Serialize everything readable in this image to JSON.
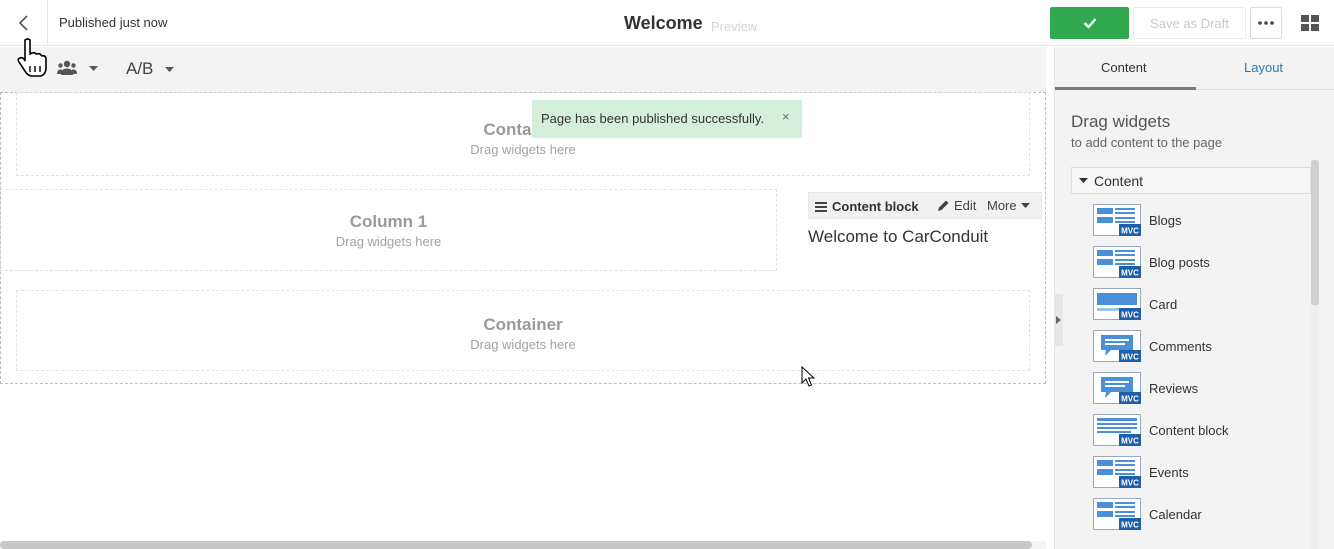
{
  "topbar": {
    "status": "Published just now",
    "title": "Welcome",
    "preview": "Preview",
    "publish_icon": "check-icon",
    "save_draft": "Save as Draft",
    "more_icon": "ellipsis-icon",
    "layout_icon": "grid-icon"
  },
  "toolbar": {
    "persona_icon": "users-icon",
    "ab_label": "A/B"
  },
  "canvas": {
    "top_container": {
      "title": "Container",
      "sub": "Drag widgets here"
    },
    "column1": {
      "title": "Column 1",
      "sub": "Drag widgets here"
    },
    "bottom_container": {
      "title": "Container",
      "sub": "Drag widgets here"
    },
    "content_block": {
      "label": "Content block",
      "edit": "Edit",
      "more": "More",
      "text": "Welcome to CarConduit"
    },
    "toast": {
      "message": "Page has been published successfully.",
      "close": "×"
    }
  },
  "panel": {
    "tabs": [
      {
        "label": "Content"
      },
      {
        "label": "Layout"
      }
    ],
    "drag_title": "Drag widgets",
    "drag_sub": "to add content to the page",
    "category": "Content",
    "badge": "MVC",
    "widgets": [
      {
        "label": "Blogs",
        "icon": "list-widget-icon"
      },
      {
        "label": "Blog posts",
        "icon": "list-widget-icon"
      },
      {
        "label": "Card",
        "icon": "card-widget-icon"
      },
      {
        "label": "Comments",
        "icon": "comment-widget-icon"
      },
      {
        "label": "Reviews",
        "icon": "comment-widget-icon"
      },
      {
        "label": "Content block",
        "icon": "text-widget-icon"
      },
      {
        "label": "Events",
        "icon": "list-widget-icon"
      },
      {
        "label": "Calendar",
        "icon": "list-widget-icon"
      }
    ]
  },
  "colors": {
    "publish_green": "#2fa84f",
    "toast_bg": "#d4efdb",
    "link_blue": "#2a7ab8",
    "mvc_badge": "#1f5fa8"
  }
}
